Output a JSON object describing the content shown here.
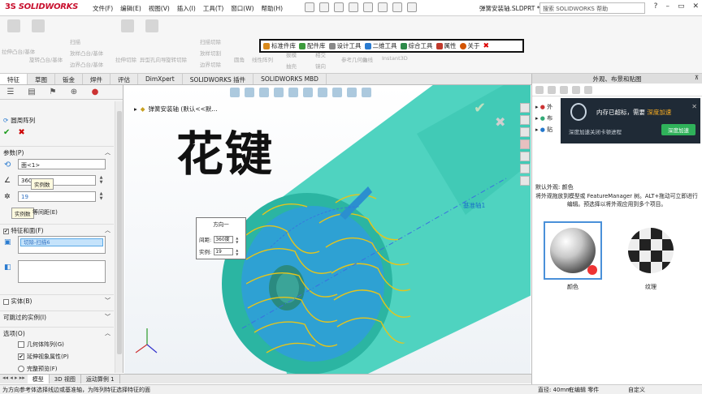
{
  "app": {
    "logo_prefix": "3S",
    "logo_brand": "SOLIDWORKS",
    "menu": [
      "文件(F)",
      "编辑(E)",
      "视图(V)",
      "插入(I)",
      "工具(T)",
      "窗口(W)",
      "帮助(H)"
    ],
    "document_title": "弹簧安装轴.SLDPRT *",
    "help_search_placeholder": "搜索 SOLIDWORKS 帮助"
  },
  "ribbon": {
    "labels": [
      "拉伸凸台/基体",
      "旋转凸台/基体",
      "扫描",
      "放样凸台/基体",
      "边界凸台/基体",
      "拉伸切除",
      "异型孔向导",
      "旋转切除",
      "扫描切除",
      "放样切割",
      "边界切除",
      "圆角",
      "线性阵列",
      "筋",
      "包覆",
      "拔模",
      "相交",
      "抽壳",
      "镜向",
      "参考几何体",
      "曲线",
      "Instant3D"
    ],
    "plugin_bar": [
      "标准件库",
      "配件库",
      "设计工具",
      "二维工具",
      "综合工具",
      "属性",
      "关于"
    ]
  },
  "command_tabs": [
    "特征",
    "草图",
    "钣金",
    "焊件",
    "评估",
    "DimXpert",
    "SOLIDWORKS 插件",
    "SOLIDWORKS MBD"
  ],
  "property_manager": {
    "title": "圆周阵列",
    "params_header": "参数(P)",
    "axis_value": "面<1>",
    "angle_value": "360",
    "angle_tip": "实例数",
    "instances_value": "19",
    "instances_tip": "实例数",
    "equal_spacing_label": "等间距(E)",
    "features_header": "特征和面(F)",
    "selected_feature": "切除-扫描6",
    "bodies_header": "实体(B)",
    "skip_header": "可跳过的实例(I)",
    "options_header": "选项(O)",
    "options": [
      {
        "label": "几何体阵列(G)",
        "checked": false
      },
      {
        "label": "延伸视象属性(P)",
        "checked": true
      },
      {
        "label": "完整预览(F)",
        "checked": false
      }
    ]
  },
  "graphics": {
    "tree_crumb": "弹簧安装轴 (默认<<默...",
    "overlay_title": "花键",
    "axis_annotation": "基准轴1",
    "callout": {
      "header": "方向一",
      "spacing_label": "间距:",
      "spacing_value": "360度",
      "instances_label": "实例:",
      "instances_value": "19"
    },
    "colors": {
      "shaft_body": "#4fd3c0",
      "shaft_dark": "#2bb5a2",
      "end_face": "#2f9fd8",
      "spline_curves": "#e6c51a",
      "axis_line": "#3a6fe0"
    }
  },
  "bottom_tabs": [
    "模型",
    "3D 视图",
    "运动算例 1"
  ],
  "status": {
    "message": "为方向参考体选择线边或基准轴，为阵列特征选择特征的面",
    "length": "直径: 40mm",
    "mode": "在编辑 零件",
    "units": "自定义"
  },
  "task_pane": {
    "title": "外观、布景和贴图",
    "notification": {
      "text": "内存已超标，需要",
      "link": "深度加速",
      "subtext": "深度加速关闭卡顿进程",
      "button": "深度加速"
    },
    "tree_items": [
      "外",
      "布",
      "贴"
    ],
    "default_appearance": "默认外观: 颜色",
    "description": "将外观拖放到模型或 FeatureManager 树。ALT+拖动可立即进行编辑。预选择以将外观应用到多个项目。",
    "swatches": [
      "颜色",
      "纹理"
    ]
  }
}
